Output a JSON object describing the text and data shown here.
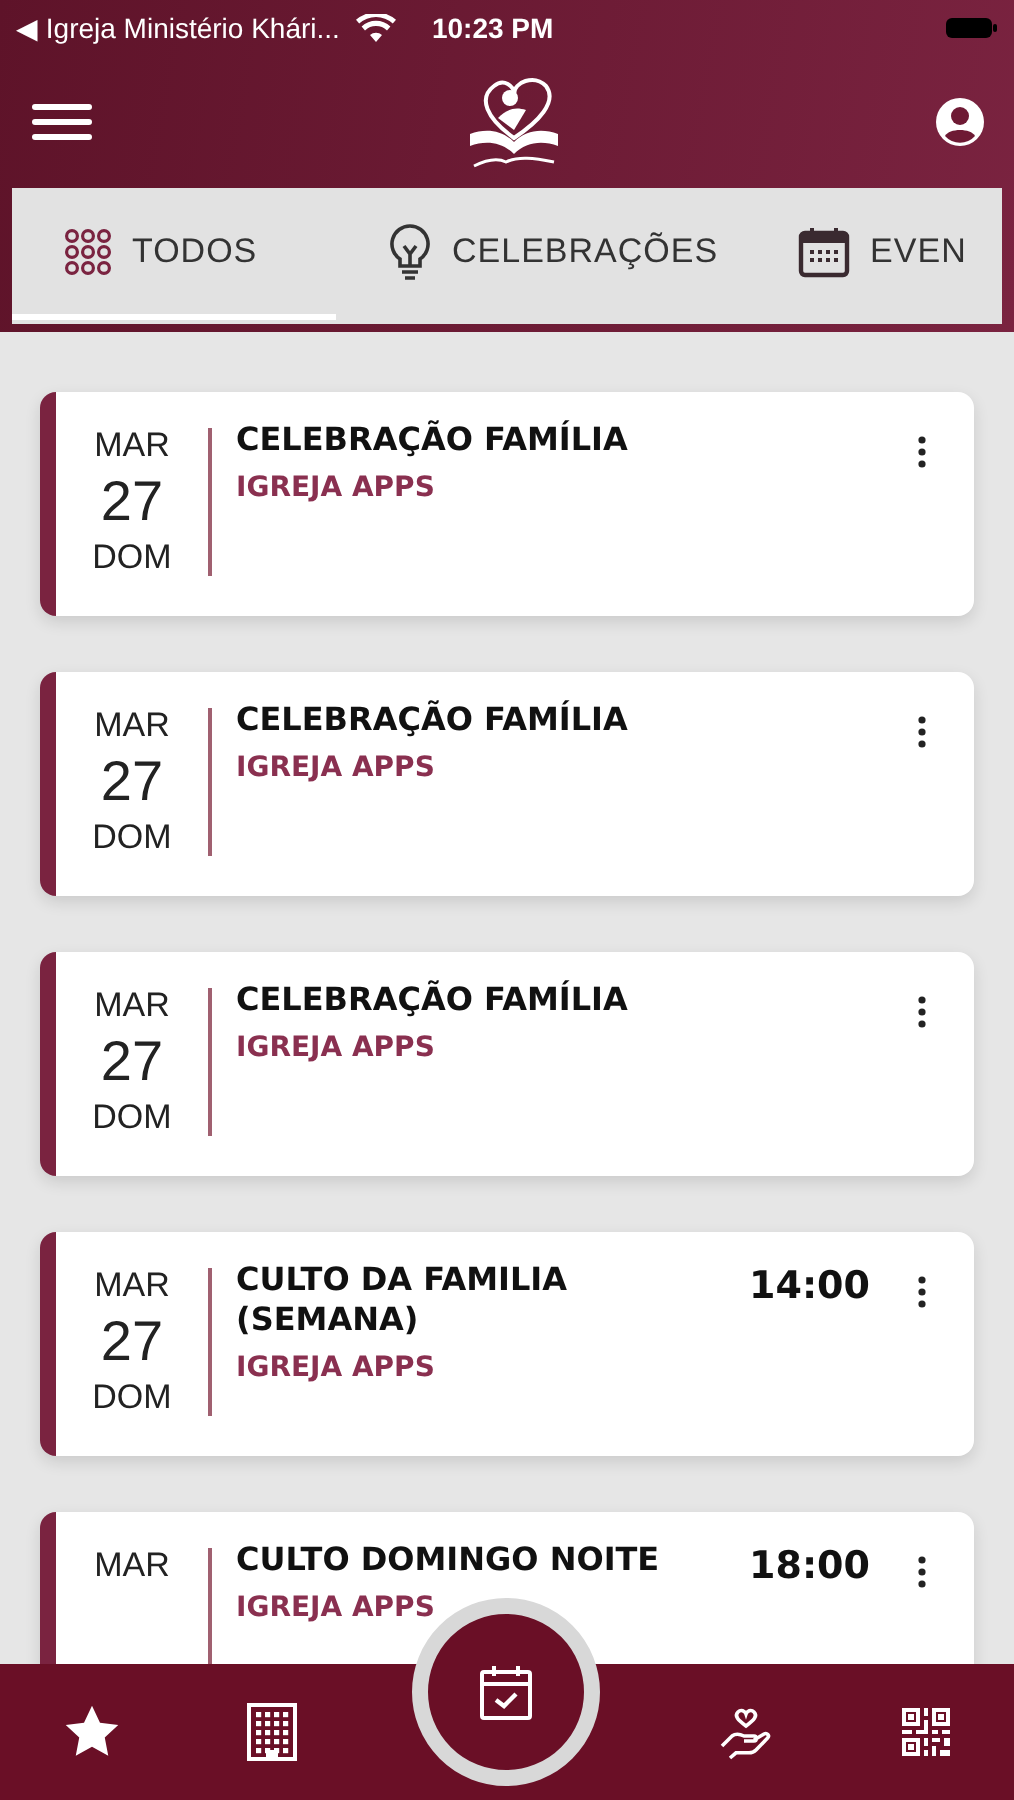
{
  "status_bar": {
    "back_app": "◀ Igreja Ministério Khári...",
    "time": "10:23 PM"
  },
  "tabs": [
    {
      "label": "TODOS",
      "kind": "grid",
      "selected": true
    },
    {
      "label": "CELEBRAÇÕES",
      "kind": "bulb",
      "selected": false
    },
    {
      "label": "EVEN",
      "kind": "calendar",
      "selected": false
    }
  ],
  "events": [
    {
      "month": "MAR",
      "day": "27",
      "weekday": "DOM",
      "title": "CELEBRAÇÃO FAMÍLIA",
      "subtitle": "IGREJA APPS"
    },
    {
      "month": "MAR",
      "day": "27",
      "weekday": "DOM",
      "title": "CELEBRAÇÃO FAMÍLIA",
      "subtitle": "IGREJA APPS"
    },
    {
      "month": "MAR",
      "day": "27",
      "weekday": "DOM",
      "title": "CELEBRAÇÃO FAMÍLIA",
      "subtitle": "IGREJA APPS"
    },
    {
      "month": "MAR",
      "day": "27",
      "weekday": "DOM",
      "title": "CULTO DA FAMILIA (SEMANA)",
      "subtitle": "IGREJA APPS",
      "time": "14:00"
    },
    {
      "month": "MAR",
      "title": "CULTO DOMINGO NOITE",
      "subtitle": "IGREJA APPS",
      "time": "18:00"
    }
  ],
  "bottom_nav": [
    {
      "kind": "star",
      "selected": false
    },
    {
      "kind": "building",
      "selected": false
    },
    {
      "kind": "calendar-check",
      "selected": true
    },
    {
      "kind": "hand-heart",
      "selected": false
    },
    {
      "kind": "qr",
      "selected": false
    }
  ]
}
